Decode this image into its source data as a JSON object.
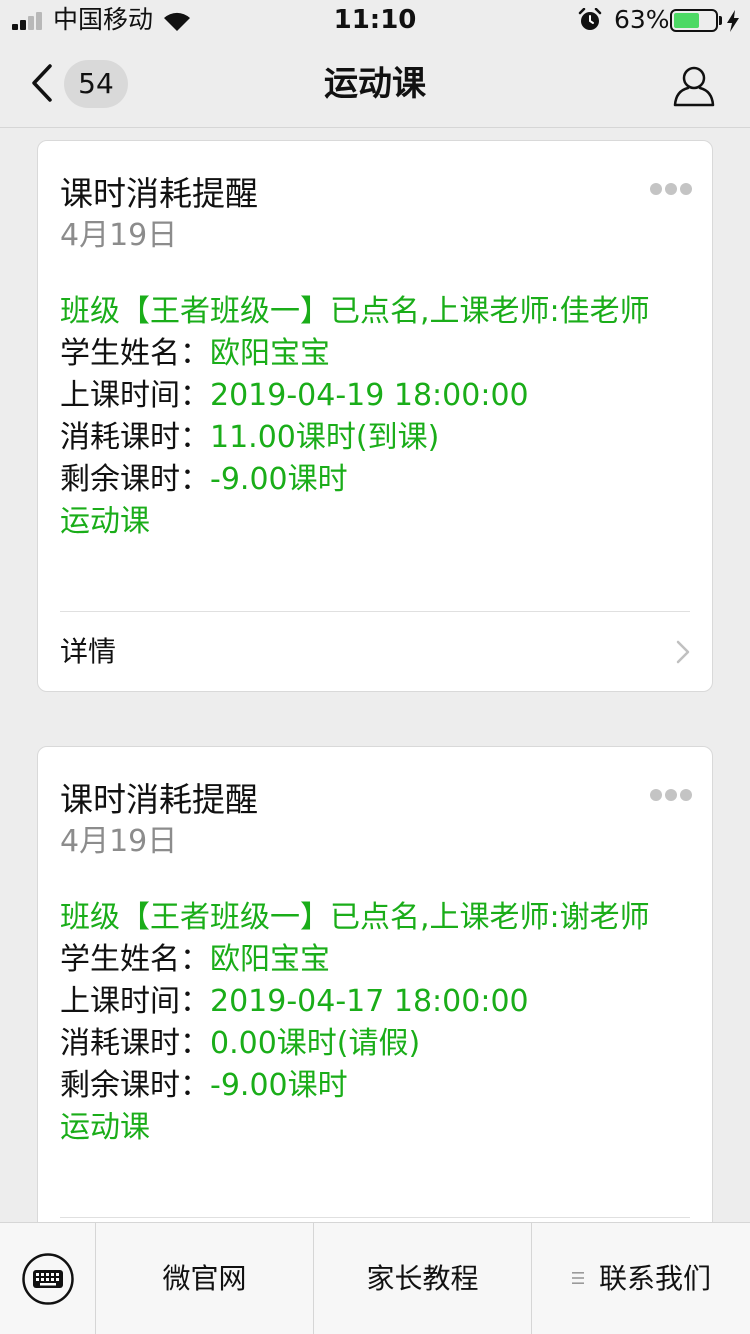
{
  "status_bar": {
    "carrier": "中国移动",
    "time": "11:10",
    "battery_percent": "63%",
    "battery_level": 0.63,
    "icons": [
      "signal-icon",
      "wifi-icon",
      "alarm-icon",
      "battery-icon",
      "charging-icon"
    ]
  },
  "nav": {
    "title": "运动课",
    "unread_count": "54",
    "icons": [
      "back-chevron-icon",
      "profile-icon"
    ]
  },
  "messages": [
    {
      "title": "课时消耗提醒",
      "date": "4月19日",
      "headline": "班级【王者班级一】已点名,上课老师:佳老师",
      "fields": [
        {
          "label": "学生姓名：",
          "value": "欧阳宝宝"
        },
        {
          "label": "上课时间：",
          "value": "2019-04-19 18:00:00"
        },
        {
          "label": "消耗课时：",
          "value": "11.00课时(到课)"
        },
        {
          "label": "剩余课时：",
          "value": "-9.00课时"
        }
      ],
      "course": "运动课",
      "detail_label": "详情"
    },
    {
      "title": "课时消耗提醒",
      "date": "4月19日",
      "headline": "班级【王者班级一】已点名,上课老师:谢老师",
      "fields": [
        {
          "label": "学生姓名：",
          "value": "欧阳宝宝"
        },
        {
          "label": "上课时间：",
          "value": "2019-04-17 18:00:00"
        },
        {
          "label": "消耗课时：",
          "value": "0.00课时(请假)"
        },
        {
          "label": "剩余课时：",
          "value": "-9.00课时"
        }
      ],
      "course": "运动课"
    }
  ],
  "bottom_menu": {
    "items": [
      "微官网",
      "家长教程",
      "联系我们"
    ],
    "icons": [
      "keyboard-icon",
      "menu-lines-icon"
    ]
  },
  "colors": {
    "accent_green": "#1aad19",
    "background": "#ededed"
  }
}
